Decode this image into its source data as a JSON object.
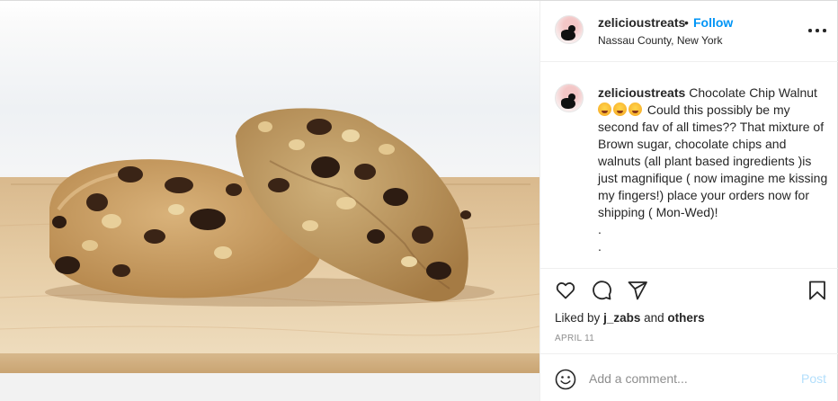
{
  "header": {
    "username": "zelicioustreats",
    "separator": "•",
    "follow_label": "Follow",
    "location": "Nassau County, New York",
    "more_icon": "more-horizontal-icon"
  },
  "post": {
    "image_description_icon": "cookie-photo",
    "caption": {
      "username": "zelicioustreats",
      "title": "Chocolate Chip Walnut",
      "emojis": [
        "😋",
        "😊",
        "😋"
      ],
      "body": "Could this possibly be my second fav of all times?? That mixture of Brown sugar, chocolate chips and walnuts (all plant based ingredients )is just magnifique ( now imagine me kissing my fingers!) place your orders now for shipping ( Mon-Wed)!\n.\n."
    }
  },
  "actions": {
    "like_icon": "heart-icon",
    "comment_icon": "comment-icon",
    "share_icon": "send-icon",
    "save_icon": "bookmark-icon",
    "liked_by_prefix": "Liked by",
    "liked_by_user": "j_zabs",
    "liked_by_and": "and",
    "liked_by_others": "others",
    "date": "APRIL 11"
  },
  "comment_box": {
    "placeholder": "Add a comment...",
    "post_label": "Post",
    "emoji_icon": "smile-icon"
  },
  "colors": {
    "accent": "#0095f6",
    "post_disabled": "#b3dffc",
    "muted": "#8e8e8e",
    "border": "#efefef"
  }
}
